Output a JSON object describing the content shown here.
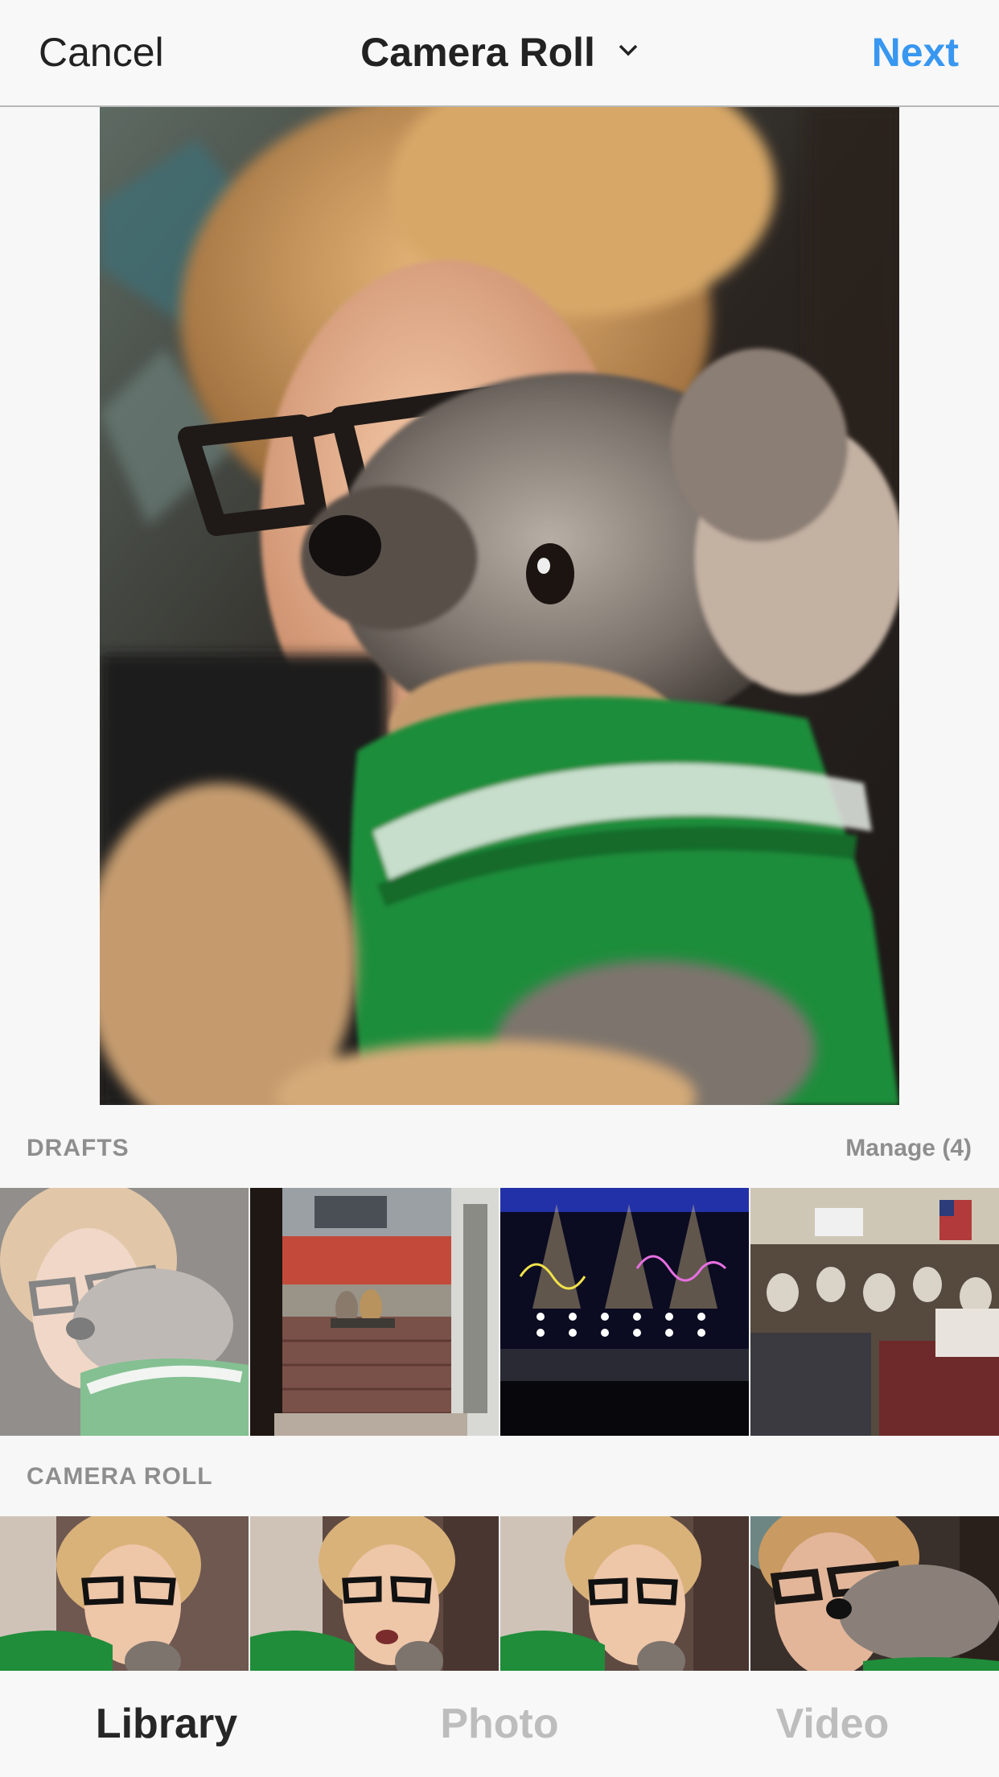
{
  "nav": {
    "cancel_label": "Cancel",
    "title": "Camera Roll",
    "next_label": "Next",
    "next_color": "#3897f0"
  },
  "drafts": {
    "label": "DRAFTS",
    "manage_label": "Manage (4)",
    "items": [
      "woman-with-dog-draft",
      "two-dogs-at-doorway",
      "concert-stage",
      "banquet-hall"
    ]
  },
  "camera_roll": {
    "label": "CAMERA ROLL",
    "items": [
      "selfie-glasses-1",
      "selfie-glasses-2",
      "selfie-glasses-3",
      "selfie-with-dog"
    ]
  },
  "tabs": [
    {
      "label": "Library",
      "active": true
    },
    {
      "label": "Photo",
      "active": false
    },
    {
      "label": "Video",
      "active": false
    }
  ],
  "colors": {
    "active_tab": "#262626",
    "inactive_tab": "#bdbdbd",
    "section_label": "#8e8e8e"
  }
}
